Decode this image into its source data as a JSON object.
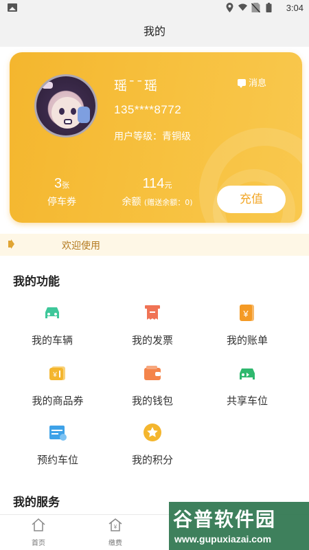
{
  "status_bar": {
    "time": "3:04",
    "icons": [
      "gallery-icon",
      "location-icon",
      "wifi-icon",
      "no-sim-icon",
      "battery-icon"
    ]
  },
  "title": "我的",
  "card": {
    "username": "瑶¯¯瑶",
    "phone": "135****8772",
    "level_label": "用户等级：青铜级",
    "message_label": "消息",
    "coupon": {
      "count": "3",
      "unit": "张",
      "label": "停车券"
    },
    "balance": {
      "amount": "114",
      "unit": "元",
      "label": "余额",
      "gift_label": "(赠送余额：0)"
    },
    "recharge_label": "充值",
    "colors": {
      "gradient_start": "#f4b62e",
      "gradient_end": "#f9c84e"
    }
  },
  "notice": {
    "text": "欢迎使用",
    "icon": "speaker-icon"
  },
  "functions": {
    "title": "我的功能",
    "items": [
      {
        "label": "我的车辆",
        "icon": "car-icon",
        "color": "#3ec79a"
      },
      {
        "label": "我的发票",
        "icon": "invoice-icon",
        "color": "#f07355"
      },
      {
        "label": "我的账单",
        "icon": "bill-icon",
        "color": "#f49a25"
      },
      {
        "label": "我的商品券",
        "icon": "voucher-icon",
        "color": "#f4b62e"
      },
      {
        "label": "我的钱包",
        "icon": "wallet-icon",
        "color": "#f4844a"
      },
      {
        "label": "共享车位",
        "icon": "shared-parking-icon",
        "color": "#2fb86e"
      },
      {
        "label": "预约车位",
        "icon": "calendar-icon",
        "color": "#3ea2e8"
      },
      {
        "label": "我的积分",
        "icon": "star-icon",
        "color": "#f4b62e"
      }
    ]
  },
  "services": {
    "title": "我的服务"
  },
  "tabbar": {
    "items": [
      {
        "label": "首页",
        "icon": "home-icon"
      },
      {
        "label": "缴费",
        "icon": "pay-icon"
      }
    ]
  },
  "watermark": {
    "big": "谷普软件园",
    "small": "www.gupuxiazai.com"
  }
}
